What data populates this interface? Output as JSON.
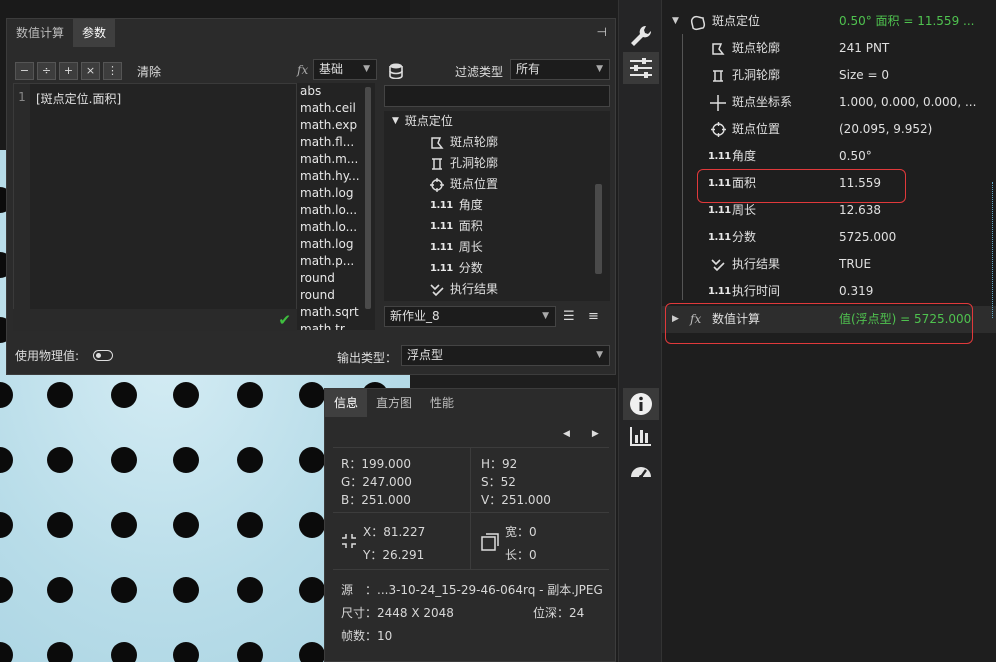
{
  "expr_dialog": {
    "tabs": [
      {
        "label": "数值计算"
      },
      {
        "label": "参数"
      }
    ],
    "ops": [
      "−",
      "÷",
      "+",
      "×",
      "⋮"
    ],
    "clear_label": "清除",
    "line_number": "1",
    "expression": "[斑点定位.面积]",
    "fx_label": "fx",
    "category_select": "基础",
    "functions": [
      "abs",
      "math.ceil",
      "math.exp",
      "math.fl...",
      "math.m...",
      "math.hy...",
      "math.log",
      "math.lo...",
      "math.lo...",
      "math.log",
      "math.p...",
      "round",
      "round",
      "math.sqrt",
      "math.tr..."
    ],
    "filter_label": "过滤类型",
    "filter_select": "所有",
    "tree_root": "斑点定位",
    "tree_items": [
      "斑点轮廓",
      "孔洞轮廓",
      "斑点位置",
      "角度",
      "面积",
      "周长",
      "分数",
      "执行结果"
    ],
    "job_select": "新作业_8",
    "physical_label": "使用物理值:",
    "output_type_label": "输出类型：",
    "output_type_select": "浮点型"
  },
  "info_panel": {
    "tabs": [
      {
        "label": "信息"
      },
      {
        "label": "直方图"
      },
      {
        "label": "性能"
      }
    ],
    "r": "R：199.000",
    "g": "G：247.000",
    "b": "B：251.000",
    "h": "H：92",
    "s": "S：52",
    "v": "V：251.000",
    "x": "X：81.227",
    "y": "Y：26.291",
    "width": "宽：0",
    "length": "长：0",
    "source": "源　：...3-10-24_15-29-46-064rq - 副本.JPEG",
    "size": "尺寸：2448 X 2048",
    "depth": "位深：24",
    "frames": "帧数：10"
  },
  "results": {
    "root": {
      "name": "斑点定位",
      "value": "0.50° 面积 = 11.559 ..."
    },
    "items": [
      {
        "name": "斑点轮廓",
        "value": "241 PNT"
      },
      {
        "name": "孔洞轮廓",
        "value": "Size = 0"
      },
      {
        "name": "斑点坐标系",
        "value": "1.000, 0.000, 0.000, ..."
      },
      {
        "name": "斑点位置",
        "value": "(20.095, 9.952)"
      },
      {
        "name": "角度",
        "value": "0.50°"
      },
      {
        "name": "面积",
        "value": "11.559"
      },
      {
        "name": "周长",
        "value": "12.638"
      },
      {
        "name": "分数",
        "value": "5725.000"
      },
      {
        "name": "执行结果",
        "value": "TRUE"
      },
      {
        "name": "执行时间",
        "value": "0.319"
      }
    ],
    "calc": {
      "name": "数值计算",
      "value": "值(浮点型) = 5725.000"
    },
    "num_icon": "1.11"
  },
  "colors": {
    "accent_green": "#4fc24f",
    "highlight_red": "#e0393b",
    "panel": "#2b2b2b"
  }
}
